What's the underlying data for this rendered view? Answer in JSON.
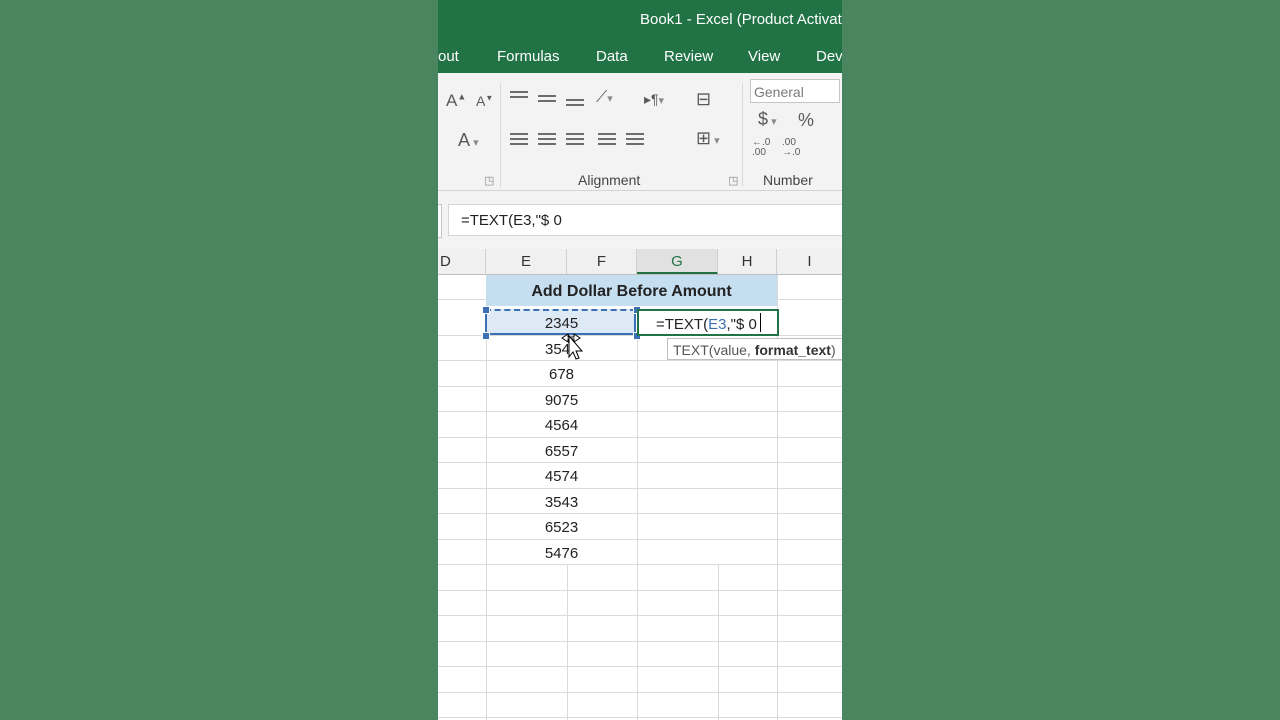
{
  "window": {
    "title": "Book1 - Excel (Product Activat"
  },
  "ribbon_tabs": [
    "out",
    "Formulas",
    "Data",
    "Review",
    "View",
    "Dev"
  ],
  "ribbon": {
    "font_grow": "A",
    "font_shrink": "A",
    "font_color": "A",
    "alignment_label": "Alignment",
    "number_label": "Number",
    "number_format": "General",
    "currency_symbol": "$",
    "percent_symbol": "%",
    "increase_decimal_top": "←.0",
    "increase_decimal_bottom": ".00",
    "decrease_decimal_top": ".00",
    "decrease_decimal_bottom": "→.0"
  },
  "formula_bar": {
    "value": "=TEXT(E3,\"$ 0"
  },
  "columns": [
    "D",
    "E",
    "F",
    "G",
    "H",
    "I"
  ],
  "active_column": "G",
  "sheet": {
    "header": "Add Dollar Before Amount",
    "values": [
      "2345",
      "354",
      "678",
      "9075",
      "4564",
      "6557",
      "4574",
      "3543",
      "6523",
      "5476"
    ]
  },
  "active_cell": {
    "prefix": "=TEXT(",
    "ref": "E3",
    "suffix": ",\"$ 0"
  },
  "tooltip": {
    "prefix": "TEXT(value, ",
    "bold": "format_text",
    "suffix": ")"
  },
  "colors": {
    "excel_green": "#217346",
    "header_fill": "#c5dff0",
    "ref_blue": "#3b6fb6"
  }
}
